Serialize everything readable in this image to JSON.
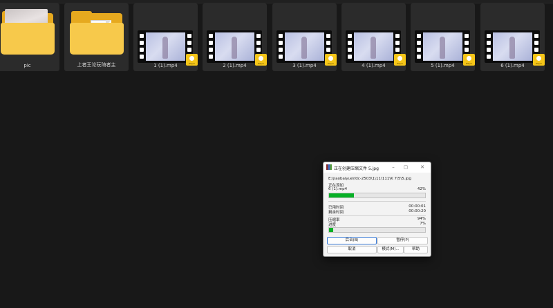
{
  "files": [
    {
      "name": "pic",
      "type": "folder-photo"
    },
    {
      "name": "上者王论玩琦者主",
      "type": "folder-doc"
    },
    {
      "name": "1 (1).mp4",
      "type": "video"
    },
    {
      "name": "2 (1).mp4",
      "type": "video"
    },
    {
      "name": "3 (1).mp4",
      "type": "video"
    },
    {
      "name": "4 (1).mp4",
      "type": "video"
    },
    {
      "name": "5 (1).mp4",
      "type": "video"
    },
    {
      "name": "6 (1).mp4",
      "type": "video"
    }
  ],
  "badge_text": "Player",
  "dialog": {
    "title": "正在创建压缩文件 5.jpg",
    "path": "E:\\jiaobaiyue\\fdc-2503\\1\\11\\111\\K 7\\5\\5.jpg",
    "adding_label": "正在添加",
    "current_file": "6 (1).mp4",
    "file_percent": "42%",
    "file_progress": 0.26,
    "elapsed_label": "已用时间",
    "elapsed_value": "00:00:01",
    "remaining_label": "剩余时间",
    "remaining_value": "00:00:20",
    "ratio_label": "压缩率",
    "ratio_value": "94%",
    "progress_label": "进度",
    "progress_value": "7%",
    "total_progress": 0.04,
    "buttons": {
      "background": "后台(B)",
      "pause": "暂停(P)",
      "cancel": "取消",
      "mode": "模式(M)...",
      "help": "帮助"
    }
  }
}
